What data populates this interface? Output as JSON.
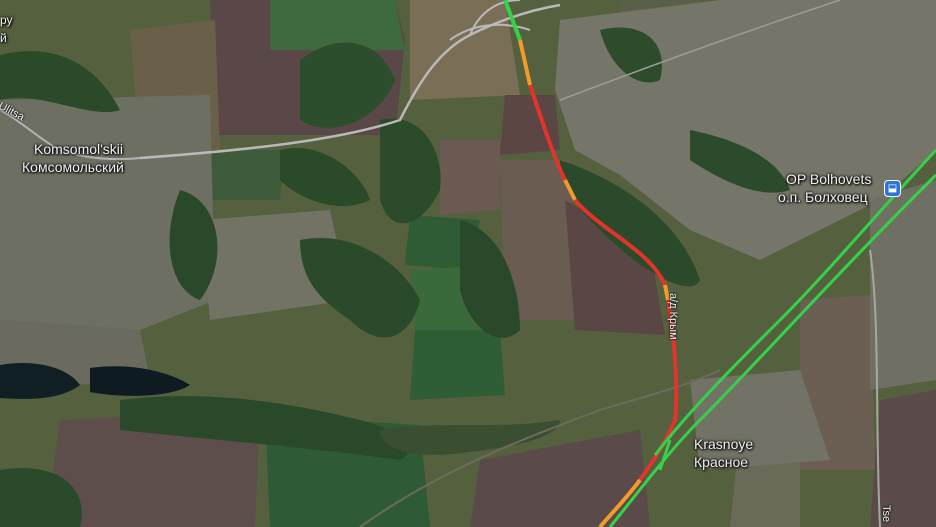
{
  "map": {
    "labels": {
      "partial_top_left": "ру",
      "partial_top_left_2": "й",
      "ulitsa": "Ulitsa",
      "komsomolskii_latin": "Komsomol'skii",
      "komsomolskii_cyr": "Комсомольский",
      "bolhovets_latin": "OP Bolhovets",
      "bolhovets_cyr": "о.п. Болховец",
      "krasnoye_latin": "Krasnoye",
      "krasnoye_cyr": "Красное",
      "road_crimea": "а/д Крым",
      "partial_bottom_right": "Tse"
    },
    "icons": {
      "station": "train-station-icon"
    },
    "colors": {
      "traffic_green": "#35d14a",
      "traffic_orange": "#f39a2b",
      "traffic_red": "#e2342a",
      "road_gray": "#b9b9b9",
      "transit_blue": "#2f74d6"
    }
  }
}
